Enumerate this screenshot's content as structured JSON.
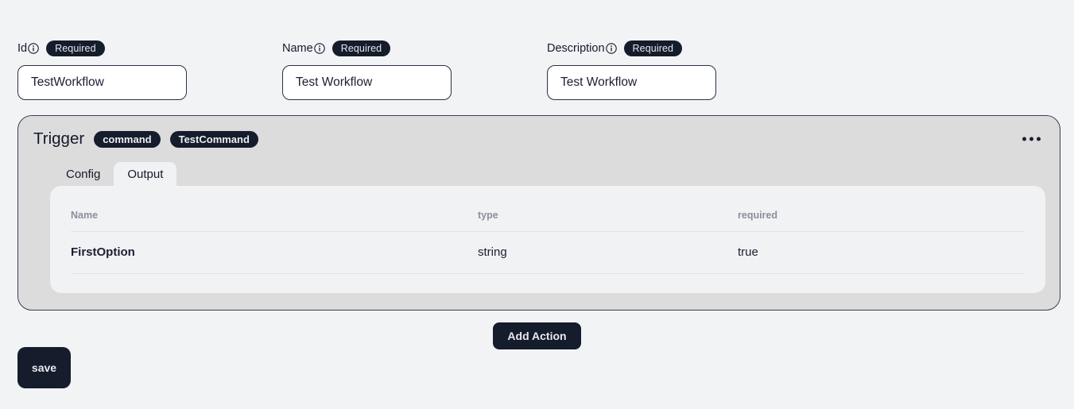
{
  "theme": {
    "page_background": "#f2f3f5",
    "panel_background": "#dcdcdd",
    "card_background": "#f1f2f4",
    "accent_dark": "#151c2c",
    "border_dark": "#3a4055",
    "muted_text": "#8b8f9c"
  },
  "form": {
    "fields": [
      {
        "label": "Id",
        "info_icon": "info-circle-icon",
        "badge": "Required",
        "value": "TestWorkflow",
        "placeholder": "Id"
      },
      {
        "label": "Name",
        "info_icon": "info-circle-icon",
        "badge": "Required",
        "value": "Test Workflow",
        "placeholder": "Name"
      },
      {
        "label": "Description",
        "info_icon": "info-circle-icon",
        "badge": "Required",
        "value": "Test Workflow",
        "placeholder": "Description"
      }
    ]
  },
  "trigger": {
    "title": "Trigger",
    "tags": [
      "command",
      "TestCommand"
    ],
    "menu_icon": "kebab-horizontal-icon",
    "tabs": [
      {
        "label": "Config",
        "active": false
      },
      {
        "label": "Output",
        "active": true
      }
    ],
    "output_table": {
      "columns": [
        "Name",
        "type",
        "required"
      ],
      "rows": [
        {
          "name": "FirstOption",
          "type": "string",
          "required": "true"
        }
      ]
    }
  },
  "actions": {
    "add_action_label": "Add Action",
    "save_label": "save"
  }
}
